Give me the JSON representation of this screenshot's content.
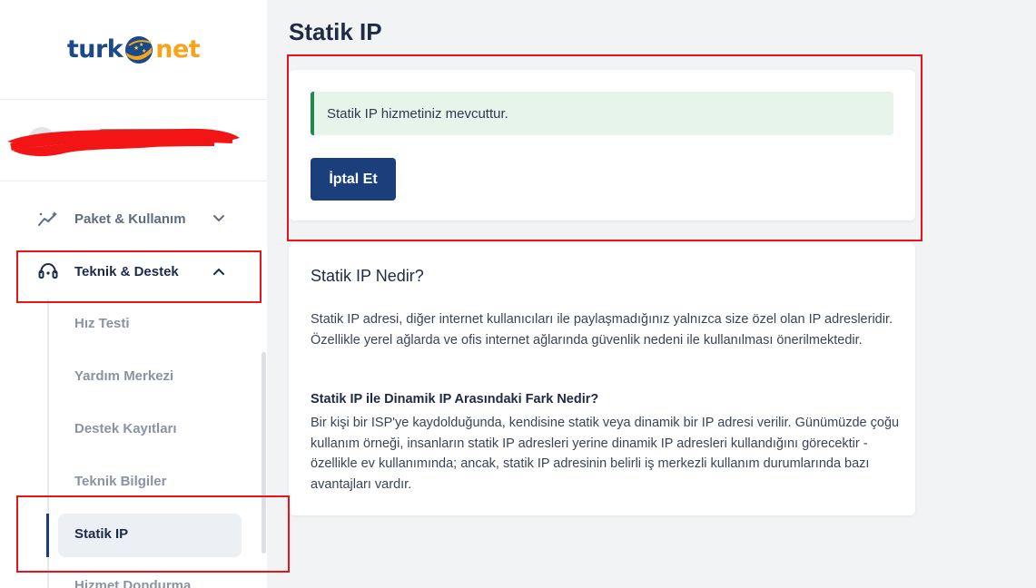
{
  "brand": {
    "logo_left": "turk",
    "logo_right": "net"
  },
  "sidebar": {
    "nav": [
      {
        "label": "Paket & Kullanım",
        "icon": "chart-sparkle-icon",
        "expanded": false
      },
      {
        "label": "Teknik & Destek",
        "icon": "headset-icon",
        "expanded": true
      }
    ],
    "sub_items": [
      "Hız Testi",
      "Yardım Merkezi",
      "Destek Kayıtları",
      "Teknik Bilgiler",
      "Statik IP",
      "Hizmet Dondurma"
    ],
    "active_sub_item": "Statik IP"
  },
  "page": {
    "title": "Statik IP"
  },
  "status_card": {
    "alert_text": "Statik IP hizmetiniz mevcuttur.",
    "cancel_label": "İptal Et"
  },
  "info_card": {
    "title": "Statik IP Nedir?",
    "paragraph1": "Statik IP adresi, diğer internet kullanıcıları ile paylaşmadığınız yalnızca size özel olan IP adresleridir. Özellikle yerel ağlarda ve ofis internet ağlarında güvenlik nedeni ile kullanılması önerilmektedir.",
    "subtitle": "Statik IP ile Dinamik IP Arasındaki Fark Nedir?",
    "paragraph2": "Bir kişi bir ISP'ye kaydolduğunda, kendisine statik veya dinamik bir IP adresi verilir. Günümüzde çoğu kullanım örneği, insanların statik IP adresleri yerine dinamik IP adresleri kullandığını görecektir - özellikle ev kullanımında; ancak, statik IP adresinin belirli iş merkezli kullanım durumlarında bazı avantajları vardır."
  },
  "colors": {
    "primary": "#1b3f7a",
    "accent": "#f4a51c",
    "success": "#1f8a4c",
    "annotation": "#e8141b"
  }
}
